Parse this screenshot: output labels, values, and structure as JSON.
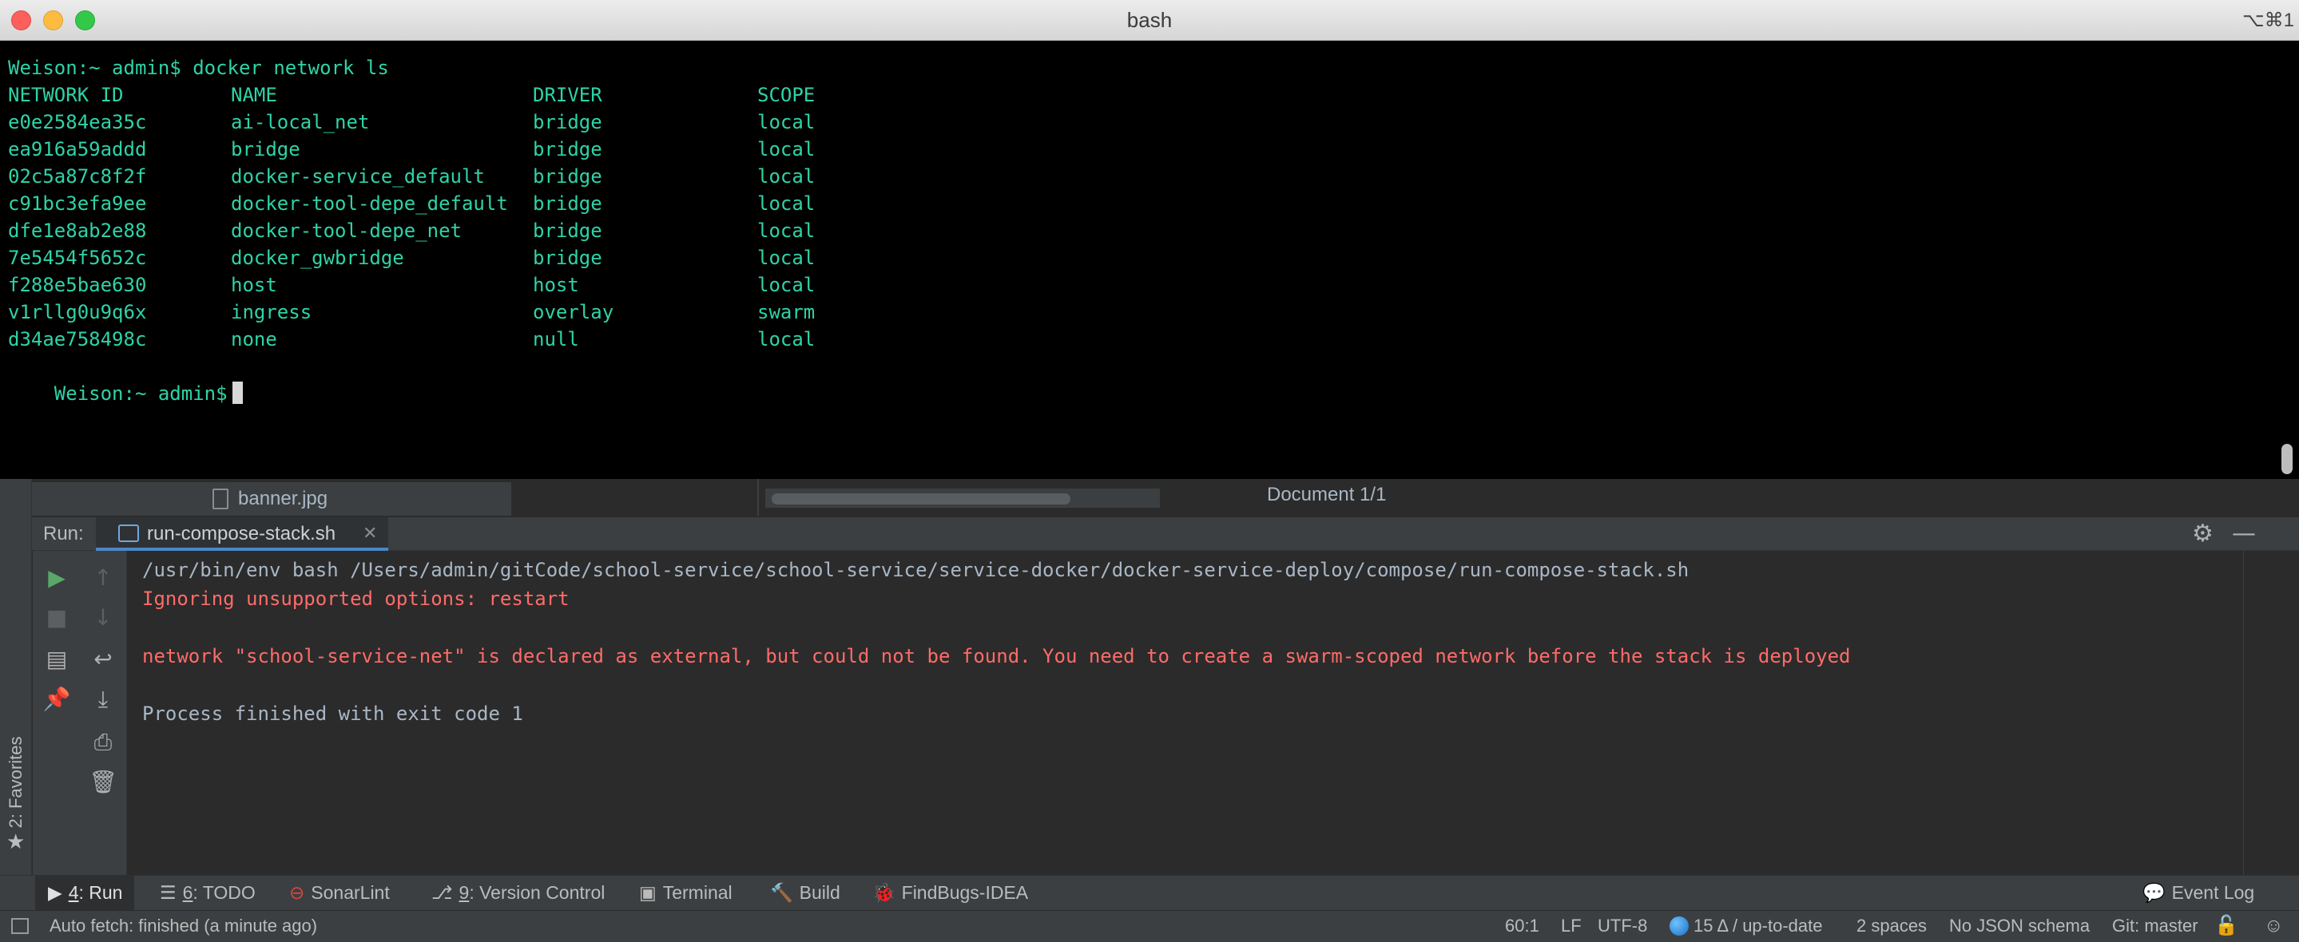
{
  "terminal": {
    "title": "bash",
    "shortcut": "⌥⌘1",
    "command_line": "Weison:~ admin$ docker network ls",
    "columns": [
      "NETWORK ID",
      "NAME",
      "DRIVER",
      "SCOPE"
    ],
    "rows": [
      [
        "e0e2584ea35c",
        "ai-local_net",
        "bridge",
        "local"
      ],
      [
        "ea916a59addd",
        "bridge",
        "bridge",
        "local"
      ],
      [
        "02c5a87c8f2f",
        "docker-service_default",
        "bridge",
        "local"
      ],
      [
        "c91bc3efa9ee",
        "docker-tool-depe_default",
        "bridge",
        "local"
      ],
      [
        "dfe1e8ab2e88",
        "docker-tool-depe_net",
        "bridge",
        "local"
      ],
      [
        "7e5454f5652c",
        "docker_gwbridge",
        "bridge",
        "local"
      ],
      [
        "f288e5bae630",
        "host",
        "host",
        "local"
      ],
      [
        "v1rllg0u9q6x",
        "ingress",
        "overlay",
        "swarm"
      ],
      [
        "d34ae758498c",
        "none",
        "null",
        "local"
      ]
    ],
    "prompt": "Weison:~ admin$",
    "text_color": "#2fd3a6"
  },
  "editor": {
    "tab_label": "banner.jpg",
    "document_label": "Document 1/1"
  },
  "run_panel": {
    "label": "Run:",
    "tab_label": "run-compose-stack.sh",
    "close_glyph": "✕",
    "console_lines": [
      {
        "text": "/usr/bin/env bash /Users/admin/gitCode/school-service/school-service/service-docker/docker-service-deploy/compose/run-compose-stack.sh",
        "color": "#a9b7c6"
      },
      {
        "text": "Ignoring unsupported options: restart",
        "color": "#ff6b68"
      },
      {
        "text": "",
        "color": "#a9b7c6"
      },
      {
        "text": "network \"school-service-net\" is declared as external, but could not be found. You need to create a swarm-scoped network before the stack is deployed",
        "color": "#ff6b68"
      },
      {
        "text": "",
        "color": "#a9b7c6"
      },
      {
        "text": "Process finished with exit code 1",
        "color": "#a9b7c6"
      }
    ],
    "toolbar_icons": [
      "rerun-icon",
      "stop-icon",
      "layout-icon",
      "pin-icon",
      "up-arrow-icon",
      "down-arrow-icon",
      "soft-wrap-icon",
      "scroll-to-end-icon",
      "print-icon",
      "trash-icon"
    ]
  },
  "sidebar": {
    "favorites_label": "2: Favorites"
  },
  "tool_tabs": [
    {
      "key": "4",
      "label": ": Run",
      "icon": "play-icon"
    },
    {
      "key": "6",
      "label": ": TODO",
      "icon": "list-icon"
    },
    {
      "key": "",
      "label": "SonarLint",
      "icon": "sonarlint-icon"
    },
    {
      "key": "9",
      "label": ": Version Control",
      "icon": "branch-icon"
    },
    {
      "key": "",
      "label": "Terminal",
      "icon": "terminal-icon"
    },
    {
      "key": "",
      "label": "Build",
      "icon": "hammer-icon"
    },
    {
      "key": "",
      "label": "FindBugs-IDEA",
      "icon": "bug-icon"
    }
  ],
  "event_log": "Event Log",
  "status_bar": {
    "message": "Auto fetch: finished (a minute ago)",
    "position": "60:1",
    "line_sep": "LF",
    "encoding": "UTF-8",
    "vcs_changes": "15 Δ / up-to-date",
    "indent": "2 spaces",
    "schema": "No JSON schema",
    "branch": "Git: master"
  },
  "colors": {
    "terminal_bg": "#000000",
    "ide_bg": "#2b2b2b",
    "error_red": "#ff6b68",
    "accent_blue": "#4a88c7"
  }
}
